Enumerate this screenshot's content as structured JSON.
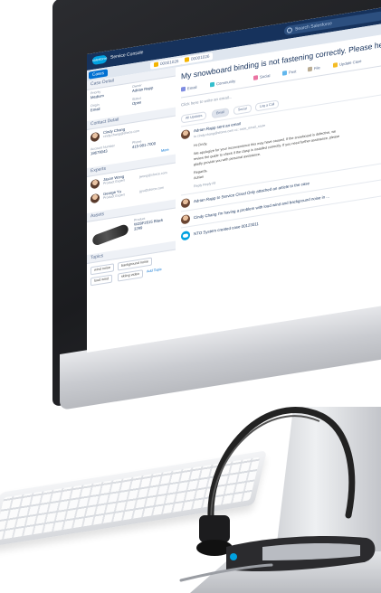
{
  "topbar": {
    "search_placeholder": "Search Salesforce",
    "app_name": "Service Console",
    "logo_text": "salesforce"
  },
  "tabs": [
    {
      "label": "Cases"
    },
    {
      "label": "00001026"
    },
    {
      "label": "00001026"
    }
  ],
  "case_detail": {
    "header": "Case Detail",
    "fields": [
      {
        "label": "Priority",
        "value": "Medium"
      },
      {
        "label": "Owner",
        "value": "Adrian Rapp"
      },
      {
        "label": "Origin",
        "value": "Email"
      },
      {
        "label": "Status",
        "value": "Open"
      }
    ]
  },
  "contact_detail": {
    "header": "Contact Detail",
    "name": "Cindy Chang",
    "email": "cindy.chang@sforce.com",
    "account_label": "Account Number",
    "account_value": "18679043",
    "phone_label": "Phone",
    "phone_value": "415-901-7000",
    "more": "More"
  },
  "experts": {
    "header": "Experts",
    "people": [
      {
        "name": "Jason Wong",
        "role": "Product Expert",
        "email": "jwong@sforce.com"
      },
      {
        "name": "George Yu",
        "role": "Product Expert",
        "email": "gyu@sforce.com"
      }
    ]
  },
  "assets": {
    "header": "Assets",
    "product_label": "Product",
    "product_value": "WZ8F2015 Black",
    "serial_value": "3299"
  },
  "topics": {
    "header": "Topics",
    "chips": [
      "wind noise",
      "background noise",
      "loud wind",
      "skiing video"
    ],
    "add": "Add Topic"
  },
  "main": {
    "title": "My snowboard binding is not fastening correctly. Please he",
    "actions": [
      "Email",
      "Community",
      "Social",
      "Post",
      "File",
      "Update Case"
    ],
    "compose_placeholder": "Click here to write an email...",
    "filters": [
      "All Updates",
      "Email",
      "Social",
      "Log a Call"
    ],
    "feed": {
      "author": "Adrian Rapp sent an email",
      "meta": "to cindy.chang@sforce.com   cc: case_email_route",
      "greeting": "Hi Cindy,",
      "body1": "We apologize for your inconvenience this may have caused. If the snowboard is defective, we",
      "body2": "review the guide to check if the clasp is installed correctly. If you need further assistance, please",
      "body3": "gladly provide you with personal assistance.",
      "regards": "Regards,",
      "sign": "Adrian",
      "actions": "Reply   Reply All",
      "item2": "Adrian Rapp to Service Cloud Only attached an article to the case",
      "item3": "Cindy Chang  I'm having a problem with loud wind and background noise in ...",
      "item4": "NTO System created case 00123011"
    }
  },
  "colors": {
    "nav": "#16325c",
    "accent": "#0070d2",
    "brand": "#00a1e0"
  }
}
